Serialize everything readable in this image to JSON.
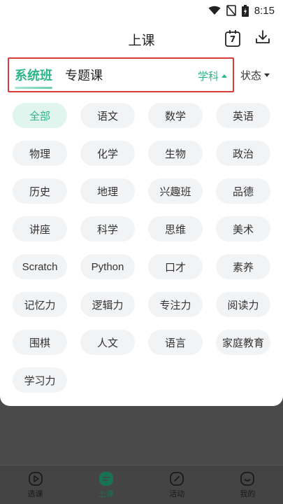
{
  "status_bar": {
    "time": "8:15"
  },
  "header": {
    "title": "上课",
    "calendar_day": "7"
  },
  "tabs": [
    {
      "label": "系统班",
      "active": true
    },
    {
      "label": "专题课",
      "active": false
    }
  ],
  "subject_dropdown": {
    "label": "学科"
  },
  "status_dropdown": {
    "label": "状态"
  },
  "subjects": [
    {
      "label": "全部",
      "active": true
    },
    {
      "label": "语文"
    },
    {
      "label": "数学"
    },
    {
      "label": "英语"
    },
    {
      "label": "物理"
    },
    {
      "label": "化学"
    },
    {
      "label": "生物"
    },
    {
      "label": "政治"
    },
    {
      "label": "历史"
    },
    {
      "label": "地理"
    },
    {
      "label": "兴趣班"
    },
    {
      "label": "品德"
    },
    {
      "label": "讲座"
    },
    {
      "label": "科学"
    },
    {
      "label": "思维"
    },
    {
      "label": "美术"
    },
    {
      "label": "Scratch"
    },
    {
      "label": "Python"
    },
    {
      "label": "口才"
    },
    {
      "label": "素养"
    },
    {
      "label": "记忆力"
    },
    {
      "label": "逻辑力"
    },
    {
      "label": "专注力"
    },
    {
      "label": "阅读力"
    },
    {
      "label": "围棋"
    },
    {
      "label": "人文"
    },
    {
      "label": "语言"
    },
    {
      "label": "家庭教育"
    },
    {
      "label": "学习力"
    }
  ],
  "bottom_nav": [
    {
      "label": "选课",
      "icon": "play-circle-icon"
    },
    {
      "label": "上课",
      "icon": "note-icon",
      "active": true
    },
    {
      "label": "活动",
      "icon": "pencil-circle-icon"
    },
    {
      "label": "我的",
      "icon": "smile-icon"
    }
  ],
  "colors": {
    "accent": "#2eb58a",
    "highlight_box": "#d93a3a",
    "chip_bg": "#f2f3f5",
    "chip_active_bg": "#dff5ee"
  }
}
